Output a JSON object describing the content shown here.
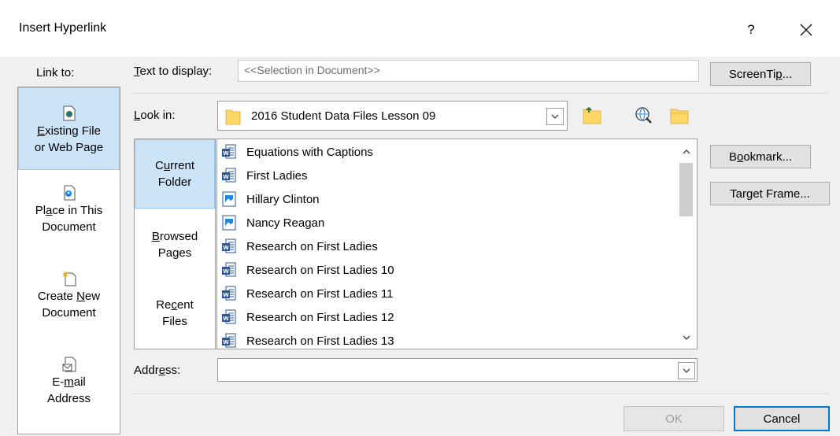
{
  "window": {
    "title": "Insert Hyperlink",
    "help_label": "?",
    "close_icon": "close-icon"
  },
  "link_to": {
    "label": "Link to:",
    "items": [
      {
        "line1_pre": "",
        "line1_u": "E",
        "line1_post": "xisting File",
        "line2": "or Web Page",
        "icon": "existing-file-icon",
        "selected": true
      },
      {
        "line1_pre": "Pl",
        "line1_u": "a",
        "line1_post": "ce in This",
        "line2": "Document",
        "icon": "place-in-document-icon",
        "selected": false
      },
      {
        "line1_pre": "Create ",
        "line1_u": "N",
        "line1_post": "ew",
        "line2": "Document",
        "icon": "create-new-document-icon",
        "selected": false
      },
      {
        "line1_pre": "E-",
        "line1_u": "m",
        "line1_post": "ail",
        "line2": "Address",
        "icon": "email-address-icon",
        "selected": false
      }
    ]
  },
  "text_to_display": {
    "label_u": "T",
    "label_rest": "ext to display:",
    "value": "<<Selection in Document>>"
  },
  "screentip": {
    "pre": "ScreenTi",
    "u": "p",
    "post": "..."
  },
  "look_in": {
    "label_u": "L",
    "label_rest": "ook in:",
    "value": "2016 Student Data Files Lesson 09",
    "icons": [
      "up-folder-icon",
      "browse-web-icon",
      "browse-file-icon"
    ]
  },
  "locations": [
    {
      "line1_pre": "C",
      "line1_u": "u",
      "line1_post": "rrent",
      "line2": "Folder",
      "selected": true
    },
    {
      "line1_pre": "",
      "line1_u": "B",
      "line1_post": "rowsed",
      "line2": "Pages",
      "selected": false
    },
    {
      "line1_pre": "Re",
      "line1_u": "c",
      "line1_post": "ent",
      "line2": "Files",
      "selected": false
    }
  ],
  "files": [
    {
      "name": "Equations with Captions",
      "type": "word"
    },
    {
      "name": "First Ladies",
      "type": "word"
    },
    {
      "name": "Hillary Clinton",
      "type": "image"
    },
    {
      "name": "Nancy Reagan",
      "type": "image"
    },
    {
      "name": "Research on First Ladies",
      "type": "word"
    },
    {
      "name": "Research on First Ladies 10",
      "type": "word"
    },
    {
      "name": "Research on First Ladies 11",
      "type": "word"
    },
    {
      "name": "Research on First Ladies 12",
      "type": "word"
    },
    {
      "name": "Research on First Ladies 13",
      "type": "word"
    }
  ],
  "bookmark": {
    "pre": "B",
    "u": "o",
    "post": "okmark..."
  },
  "target_frame": {
    "pre": "Tar",
    "u": "g",
    "post": "et Frame..."
  },
  "address": {
    "label_pre": "Addr",
    "label_u": "e",
    "label_post": "ss:",
    "value": ""
  },
  "ok_label": "OK",
  "cancel_label": "Cancel",
  "colors": {
    "selected_bg": "#cce4f7",
    "selected_border": "#99c9ef",
    "dialog_bg": "#f0f0f0",
    "word_icon_blue": "#2b579a",
    "folder_yellow": "#ffd766"
  }
}
